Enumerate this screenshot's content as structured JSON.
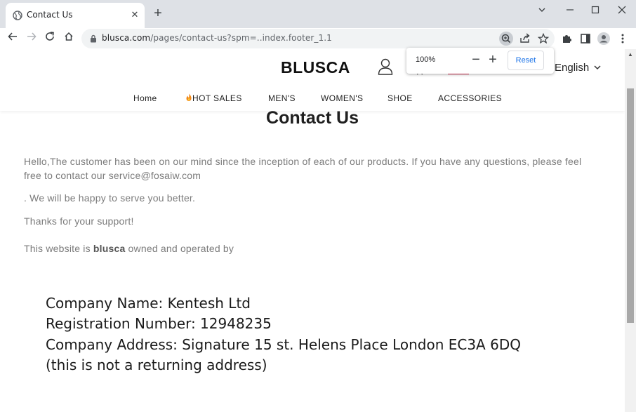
{
  "browser": {
    "tab_title": "Contact Us",
    "url_host": "blusca.com",
    "url_path": "/pages/contact-us?spm=..index.footer_1.1",
    "zoom_value": "100%",
    "zoom_reset_label": "Reset",
    "colors": {
      "tabstrip": "#dee1e6",
      "omnibox": "#f1f3f4",
      "link_blue": "#1a73e8"
    }
  },
  "site": {
    "logo": "BLUSCA",
    "language": "English",
    "nav": [
      "Home",
      "HOT SALES",
      "MEN'S",
      "WOMEN'S",
      "SHOE",
      "ACCESSORIES"
    ],
    "hot_icon": "fire-icon",
    "accent": "#e0284f"
  },
  "content": {
    "title": "Contact Us",
    "para1": "Hello,The customer has been on our mind since the inception of each of our products. If you have any questions, please feel free to contact our service@fosaiw.com",
    "para2": ". We will be happy to serve you better.",
    "para3": "Thanks for your support!",
    "para4_prefix": "This website is ",
    "para4_brand": "blusca",
    "para4_suffix": " owned and operated by",
    "company_lines": [
      "Company Name: Kentesh Ltd",
      "Registration Number: 12948235",
      "Company Address: Signature 15 st. Helens Place London EC3A 6DQ",
      "(this is not a returning address)"
    ]
  }
}
